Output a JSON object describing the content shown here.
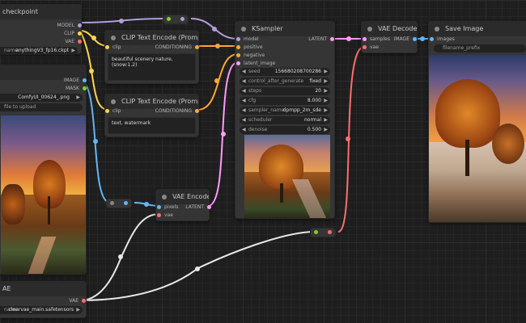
{
  "colors": {
    "model": "#b39ddb",
    "clip": "#ffd54f",
    "vae": "#ff6e6e",
    "conditioning": "#ffa931",
    "latent": "#ff9cf9",
    "image": "#64b5f6",
    "link_white": "#e8e8e8",
    "reroute_dot": "#7ed321"
  },
  "checkpoint_node": {
    "title": "checkpoint",
    "outputs": [
      "MODEL",
      "CLIP",
      "VAE"
    ],
    "ckpt_name_label": "name",
    "ckpt_name": "anythingV3_fp16.ckpt"
  },
  "load_image_node": {
    "outputs": [
      "IMAGE",
      "MASK"
    ],
    "image_name": "ComfyUI_00624_.png",
    "upload_label": "file to upload"
  },
  "clip_positive": {
    "title": "CLIP Text Encode (Prompt)",
    "input": "clip",
    "output": "CONDITIONING",
    "text": "beautiful scenery nature, (snow:1.2)"
  },
  "clip_negative": {
    "title": "CLIP Text Encode (Prompt)",
    "input": "clip",
    "output": "CONDITIONING",
    "text": "text, watermark"
  },
  "ksampler": {
    "title": "KSampler",
    "inputs": [
      "model",
      "positive",
      "negative",
      "latent_image"
    ],
    "output": "LATENT",
    "widgets": [
      {
        "label": "seed",
        "value": "156680208700286"
      },
      {
        "label": "control_after_generate",
        "value": "fixed"
      },
      {
        "label": "steps",
        "value": "20"
      },
      {
        "label": "cfg",
        "value": "8.000"
      },
      {
        "label": "sampler_name",
        "value": "dpmpp_2m_sde"
      },
      {
        "label": "scheduler",
        "value": "normal"
      },
      {
        "label": "denoise",
        "value": "0.500"
      }
    ]
  },
  "vae_decode": {
    "title": "VAE Decode",
    "inputs": [
      "samples",
      "vae"
    ],
    "output": "IMAGE"
  },
  "save_image": {
    "title": "Save Image",
    "input": "images",
    "filename_prefix": "filename_prefix"
  },
  "vae_encode": {
    "title": "VAE Encode",
    "inputs": [
      "pixels",
      "vae"
    ],
    "output": "LATENT"
  },
  "vae_loader": {
    "title": "AE",
    "output": "VAE",
    "vae_name_label": "name",
    "vae_name": "clearvae_main.safetensors"
  },
  "arrows": {
    "left": "◀",
    "right": "▶"
  }
}
